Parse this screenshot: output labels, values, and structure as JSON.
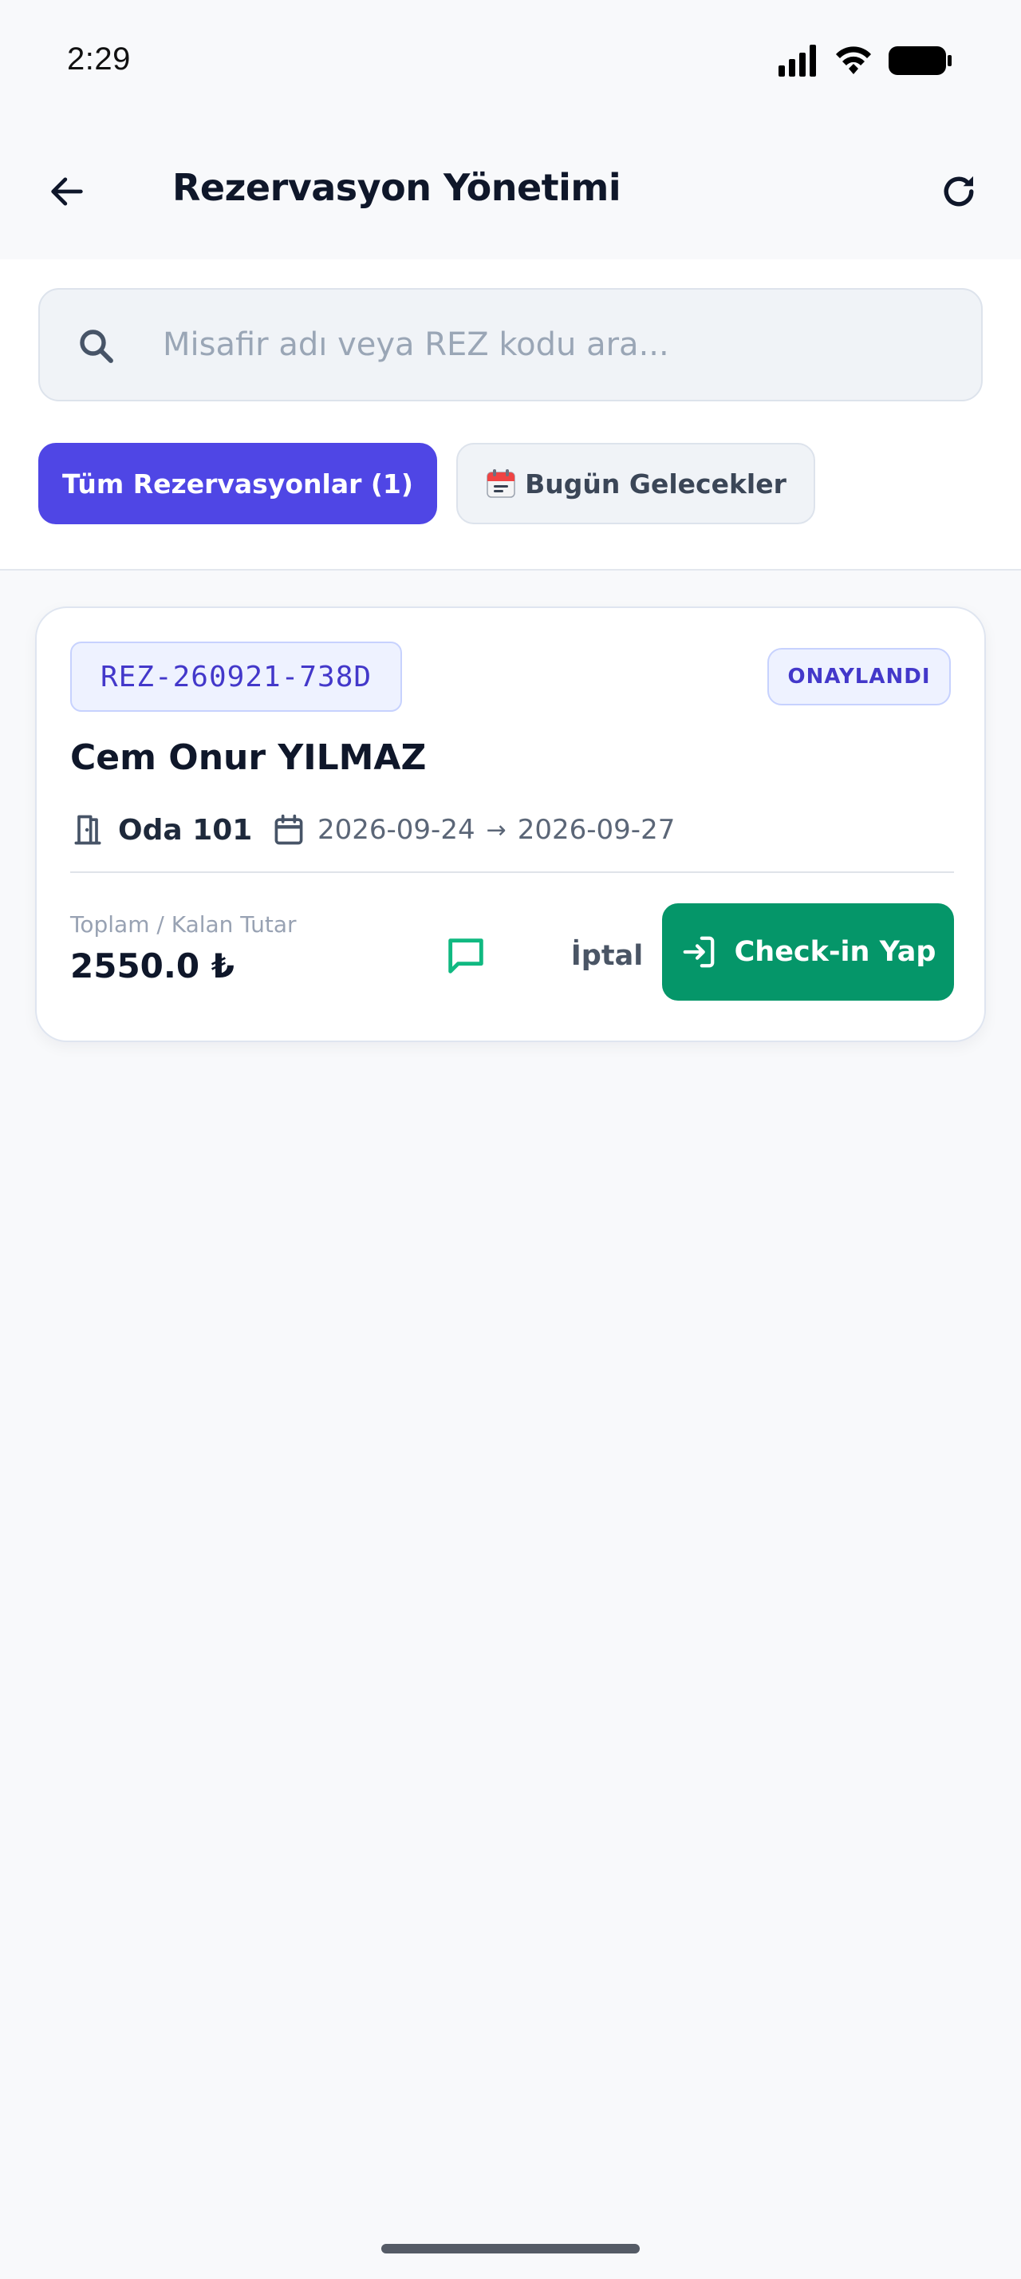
{
  "status_bar": {
    "time": "2:29"
  },
  "header": {
    "title": "Rezervasyon Yönetimi",
    "back_icon": "arrow-left-icon",
    "refresh_icon": "refresh-icon"
  },
  "search": {
    "placeholder": "Misafir adı veya REZ kodu ara...",
    "value": "",
    "icon": "search-icon"
  },
  "filters": {
    "all_label": "Tüm Rezervasyonlar (1)",
    "today_label": "Bugün Gelecekler",
    "active": "all"
  },
  "reservations": [
    {
      "code": "REZ-260921-738D",
      "status": "ONAYLANDI",
      "guest_name": "Cem Onur YILMAZ",
      "room": "Oda 101",
      "check_in": "2026-09-24",
      "arrow": "→",
      "check_out": "2026-09-27",
      "amount_label": "Toplam / Kalan Tutar",
      "amount": "2550.0 ₺",
      "cancel_label": "İptal",
      "checkin_label": "Check-in Yap"
    }
  ],
  "colors": {
    "primary": "#4f46e5",
    "success": "#059669",
    "background": "#f8f9fb",
    "card": "#ffffff",
    "badge_bg": "#eef2ff",
    "badge_text": "#4338ca",
    "message_icon": "#10b981"
  }
}
